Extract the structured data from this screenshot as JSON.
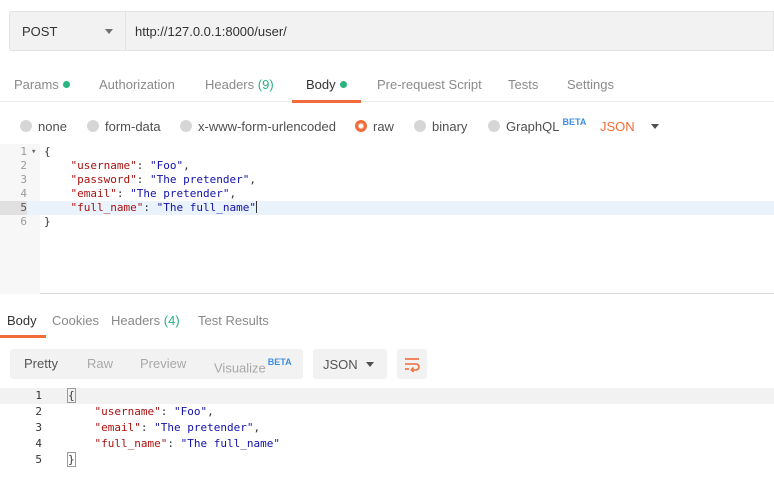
{
  "request": {
    "method": "POST",
    "url": "http://127.0.0.1:8000/user/"
  },
  "request_tabs": [
    {
      "label": "Params",
      "dot": true
    },
    {
      "label": "Authorization"
    },
    {
      "label": "Headers",
      "count": "(9)"
    },
    {
      "label": "Body",
      "dot": true,
      "active": true
    },
    {
      "label": "Pre-request Script"
    },
    {
      "label": "Tests"
    },
    {
      "label": "Settings"
    }
  ],
  "body_types": {
    "options": [
      "none",
      "form-data",
      "x-www-form-urlencoded",
      "raw",
      "binary",
      "GraphQL"
    ],
    "selected": "raw",
    "graphql_badge": "BETA",
    "format": "JSON"
  },
  "request_body": {
    "lines": [
      {
        "n": "1",
        "text": "{"
      },
      {
        "n": "2",
        "key": "\"username\"",
        "value": "\"Foo\"",
        "tail": ","
      },
      {
        "n": "3",
        "key": "\"password\"",
        "value": "\"The pretender\"",
        "tail": ","
      },
      {
        "n": "4",
        "key": "\"email\"",
        "value": "\"The pretender\"",
        "tail": ","
      },
      {
        "n": "5",
        "key": "\"full_name\"",
        "value": "\"The full_name\"",
        "tail": ""
      },
      {
        "n": "6",
        "text": "}"
      }
    ],
    "highlighted_line": "5"
  },
  "response_tabs": [
    {
      "label": "Body",
      "active": true
    },
    {
      "label": "Cookies"
    },
    {
      "label": "Headers",
      "count": "(4)"
    },
    {
      "label": "Test Results"
    }
  ],
  "response_view": {
    "buttons": [
      "Pretty",
      "Raw",
      "Preview",
      "Visualize"
    ],
    "visualize_badge": "BETA",
    "format": "JSON",
    "wrap_icon": "wrap-lines-icon"
  },
  "response_body": {
    "lines": [
      {
        "n": "1",
        "text": "{"
      },
      {
        "n": "2",
        "key": "\"username\"",
        "value": "\"Foo\"",
        "tail": ","
      },
      {
        "n": "3",
        "key": "\"email\"",
        "value": "\"The pretender\"",
        "tail": ","
      },
      {
        "n": "4",
        "key": "\"full_name\"",
        "value": "\"The full_name\"",
        "tail": ""
      },
      {
        "n": "5",
        "text": "}"
      }
    ]
  },
  "colors": {
    "accent": "#f26b3a",
    "active_dot": "#26b47f",
    "json_key": "#aa1111",
    "json_string": "#1111aa",
    "beta_badge": "#3e8de0"
  }
}
